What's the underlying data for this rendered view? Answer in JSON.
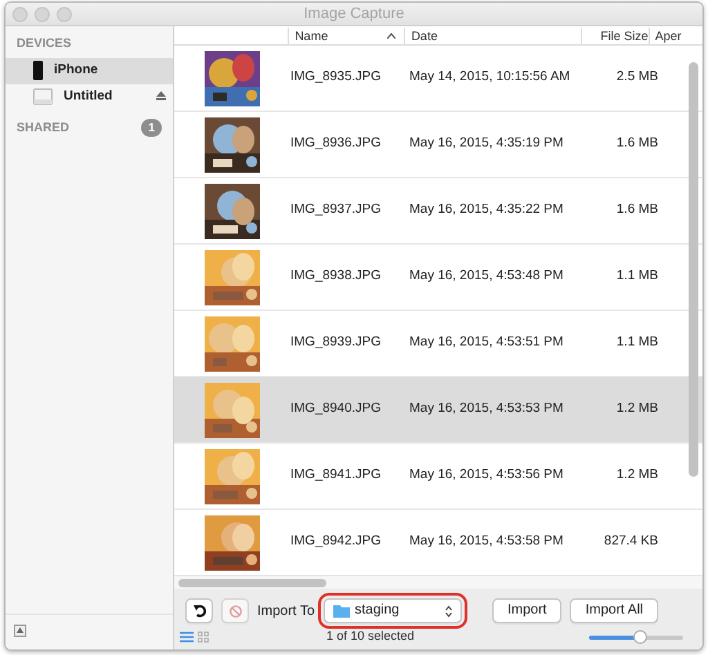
{
  "window": {
    "title": "Image Capture"
  },
  "sidebar": {
    "sections": [
      {
        "heading": "DEVICES",
        "items": [
          {
            "kind": "phone",
            "label": "iPhone",
            "selected": true,
            "eject": false
          },
          {
            "kind": "disk",
            "label": "Untitled",
            "selected": false,
            "eject": true
          }
        ]
      },
      {
        "heading": "SHARED",
        "count": "1"
      }
    ]
  },
  "table": {
    "columns": [
      {
        "label": "Name",
        "sorted_ascending": true
      },
      {
        "label": "Date"
      },
      {
        "label": "File Size"
      },
      {
        "label": "Aper"
      }
    ],
    "rows": [
      {
        "name": "IMG_8935.JPG",
        "date": "May 14, 2015, 10:15:56 AM",
        "size": "2.5 MB",
        "selected": false
      },
      {
        "name": "IMG_8936.JPG",
        "date": "May 16, 2015, 4:35:19 PM",
        "size": "1.6 MB",
        "selected": false
      },
      {
        "name": "IMG_8937.JPG",
        "date": "May 16, 2015, 4:35:22 PM",
        "size": "1.6 MB",
        "selected": false
      },
      {
        "name": "IMG_8938.JPG",
        "date": "May 16, 2015, 4:53:48 PM",
        "size": "1.1 MB",
        "selected": false
      },
      {
        "name": "IMG_8939.JPG",
        "date": "May 16, 2015, 4:53:51 PM",
        "size": "1.1 MB",
        "selected": false
      },
      {
        "name": "IMG_8940.JPG",
        "date": "May 16, 2015, 4:53:53 PM",
        "size": "1.2 MB",
        "selected": true
      },
      {
        "name": "IMG_8941.JPG",
        "date": "May 16, 2015, 4:53:56 PM",
        "size": "1.2 MB",
        "selected": false
      },
      {
        "name": "IMG_8942.JPG",
        "date": "May 16, 2015, 4:53:58 PM",
        "size": "827.4 KB",
        "selected": false
      }
    ]
  },
  "toolbar": {
    "import_to_label": "Import To",
    "destination": "staging",
    "destination_highlighted": true,
    "delete_disabled": true,
    "buttons": [
      "Import",
      "Import All"
    ]
  },
  "status": {
    "text": "1 of 10 selected",
    "views": [
      {
        "kind": "list",
        "selected": true
      },
      {
        "kind": "grid",
        "selected": false
      }
    ],
    "zoom": {
      "level": 0.55
    }
  }
}
